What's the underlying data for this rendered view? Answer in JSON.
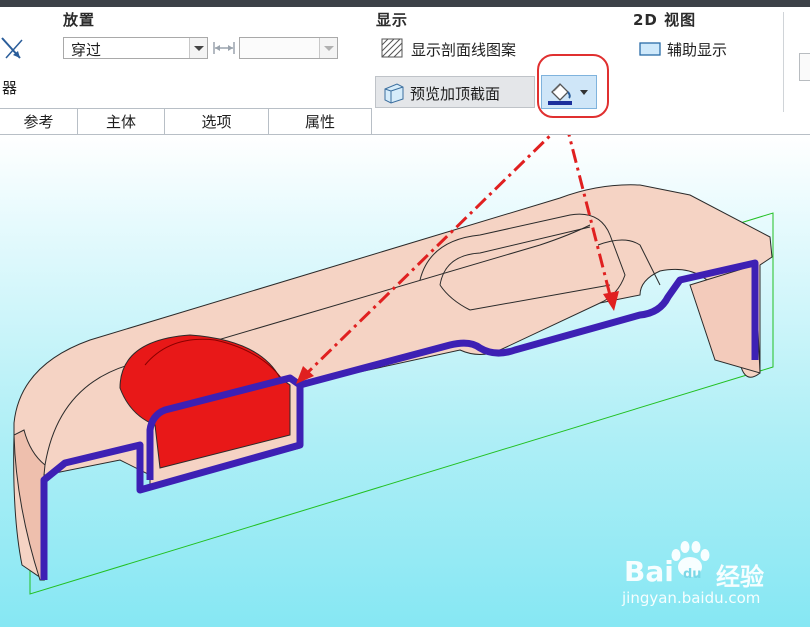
{
  "ribbon": {
    "placement": {
      "title": "放置",
      "type_value": "穿过",
      "depth_value": ""
    },
    "display": {
      "title": "显示",
      "show_hatch_label": "显示剖面线图案",
      "preview_cap_label": "预览加顶截面"
    },
    "view2d": {
      "title": "2D 视图",
      "aux_display_label": "辅助显示"
    },
    "left_partial_label": "器",
    "tabs": [
      "参考",
      "主体",
      "选项",
      "属性"
    ]
  },
  "watermark": {
    "brand": "Bai",
    "brand2": "du",
    "suffix": "经验",
    "url": "jingyan.baidu.com"
  },
  "colors": {
    "part_fill": "#f5d3c4",
    "section_edge": "#3d20b4",
    "cap_red": "#e81818",
    "arrow_red": "#e02020",
    "plane_green": "#22c022",
    "highlight_button": "#cfe6f8"
  },
  "icons": [
    "diagonal-arrow-icon",
    "dimension-icon",
    "hatch-pattern-icon",
    "cap-preview-icon",
    "paint-bucket-icon",
    "aux-display-icon",
    "paw-icon"
  ]
}
